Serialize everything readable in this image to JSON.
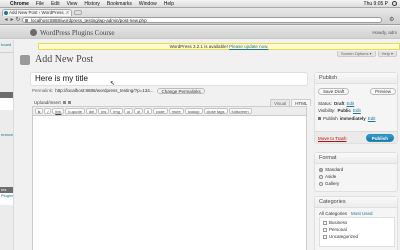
{
  "menubar": {
    "app": "Chrome",
    "items": [
      "File",
      "Edit",
      "View",
      "History",
      "Bookmarks",
      "Window",
      "Help"
    ],
    "clock": "Thu 9:05 P"
  },
  "browser": {
    "tab_title": "Add New Post ‹ WordPress ...",
    "url": "localhost:8888/wordpress_testing/wp-admin/post-new.php"
  },
  "admin": {
    "sidebar_items": [
      "board",
      "",
      "",
      "",
      "erance",
      "",
      "",
      "",
      "",
      "",
      "",
      "",
      "",
      "",
      "",
      "",
      "",
      "",
      "",
      "ms",
      "Plugins",
      ""
    ],
    "site_title": "WordPress Plugins Course",
    "howdy": "Howdy, adm"
  },
  "notice": {
    "text": "WordPress 3.2.1 is available!",
    "link": "Please update now."
  },
  "screen_tabs": [
    "Screen Options ▾",
    "Help ▾"
  ],
  "page": {
    "title": "Add New Post"
  },
  "post": {
    "title_value": "Here is my title",
    "permalink_label": "Permalink:",
    "permalink_url": "http://localhost:8888/wordpress_testing/?p=134...",
    "change_permalink": "Change Permalinks",
    "upload_label": "Upload/Insert",
    "mode_tabs": [
      "Visual",
      "HTML"
    ],
    "quicktags": [
      "b",
      "i",
      "link",
      "b-quote",
      "del",
      "ins",
      "img",
      "ul",
      "ol",
      "li",
      "code",
      "more",
      "lookup",
      "close tags",
      "fullscreen"
    ]
  },
  "publish": {
    "heading": "Publish",
    "save_draft": "Save Draft",
    "preview": "Preview",
    "status_label": "Status:",
    "status_value": "Draft",
    "visibility_label": "Visibility:",
    "visibility_value": "Public",
    "schedule_label": "Publish",
    "schedule_value": "immediately",
    "edit": "Edit",
    "trash": "Move to Trash",
    "publish_btn": "Publish"
  },
  "format": {
    "heading": "Format",
    "options": [
      "Standard",
      "Aside",
      "Gallery"
    ],
    "selected": "Standard"
  },
  "categories": {
    "heading": "Categories",
    "tabs": [
      "All Categories",
      "Most Used"
    ],
    "items": [
      "Business",
      "Personal",
      "Uncategorized"
    ]
  }
}
